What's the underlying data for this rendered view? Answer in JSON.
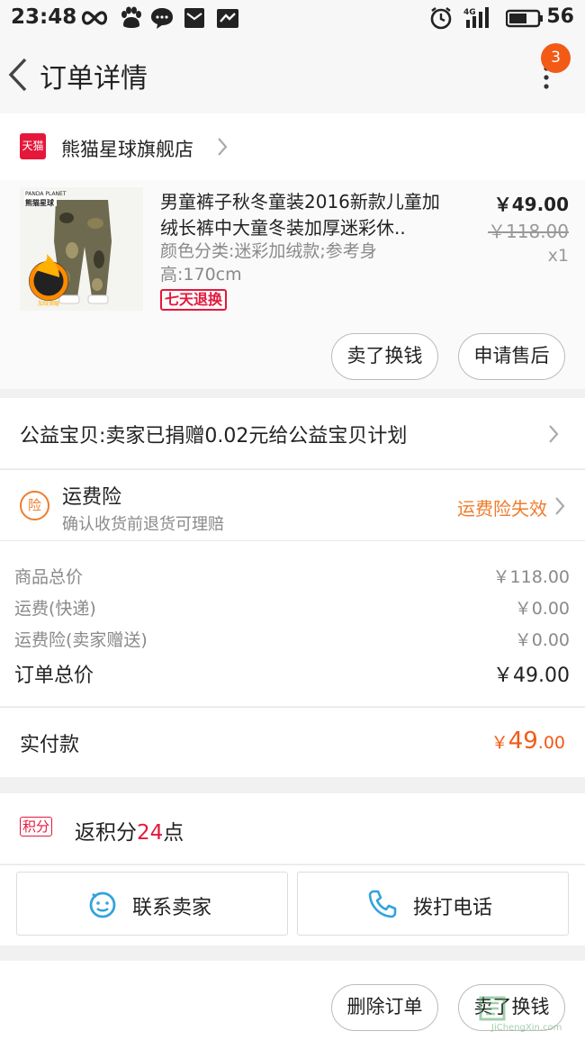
{
  "status_bar": {
    "time": "23:48",
    "network": "4G",
    "battery": "56"
  },
  "header": {
    "title": "订单详情",
    "badge_count": "3"
  },
  "shop": {
    "platform_logo": "天猫",
    "name": "熊猫星球旗舰店"
  },
  "product": {
    "title": "男童裤子秋冬童装2016新款儿童加绒长裤中大童冬装加厚迷彩休..",
    "spec": "颜色分类:迷彩加绒款;参考身高:170cm",
    "tag": "七天退换",
    "price": "￥49.00",
    "original_price": "￥118.00",
    "quantity": "x1",
    "thumb_brand": "PANDA PLANET",
    "thumb_brand_cn": "熊猫星球",
    "thumb_badge": "加绒保暖",
    "actions": [
      "卖了换钱",
      "申请售后"
    ]
  },
  "charity": {
    "text": "公益宝贝:卖家已捐赠0.02元给公益宝贝计划"
  },
  "insurance": {
    "icon_text": "险",
    "title": "运费险",
    "subtitle": "确认收货前退货可理赔",
    "status": "运费险失效"
  },
  "summary": {
    "rows": [
      {
        "label": "商品总价",
        "value": "￥118.00"
      },
      {
        "label": "运费(快递)",
        "value": "￥0.00"
      },
      {
        "label": "运费险(卖家赠送)",
        "value": "￥0.00"
      }
    ],
    "total_label": "订单总价",
    "total_value": "￥49.00"
  },
  "payment": {
    "label": "实付款",
    "currency": "￥",
    "integer": "49",
    "decimal": ".00"
  },
  "points": {
    "tag": "积分",
    "prefix": "返积分",
    "value": "24",
    "suffix": "点"
  },
  "contact": {
    "seller_label": "联系卖家",
    "phone_label": "拨打电话"
  },
  "footer": {
    "actions": [
      "删除订单",
      "卖了换钱"
    ]
  },
  "watermark": {
    "text": "JiChengXin.com"
  },
  "colors": {
    "accent_orange": "#f25a16",
    "tmall_red": "#e5173b",
    "insurance_orange": "#f07c2b"
  }
}
